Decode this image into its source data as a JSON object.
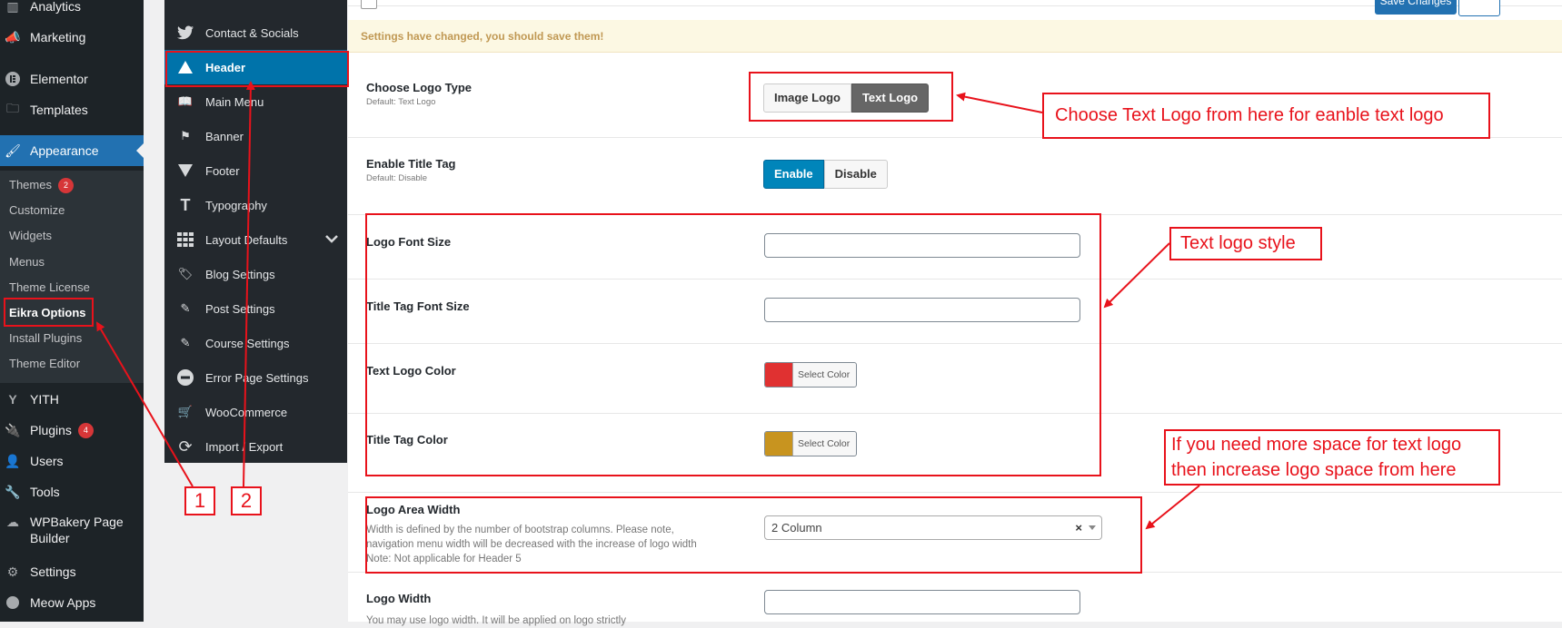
{
  "wp_menu": {
    "items": [
      {
        "label": "Analytics",
        "icon": "bar-chart-icon"
      },
      {
        "label": "Marketing",
        "icon": "megaphone-icon"
      },
      {
        "label": "Elementor",
        "icon": "elementor-icon"
      },
      {
        "label": "Templates",
        "icon": "folder-icon"
      },
      {
        "label": "Appearance",
        "icon": "paintbrush-icon"
      },
      {
        "label": "YITH",
        "icon": "yith-icon"
      },
      {
        "label": "Plugins",
        "icon": "plugin-icon",
        "badge": "4"
      },
      {
        "label": "Users",
        "icon": "user-icon"
      },
      {
        "label": "Tools",
        "icon": "wrench-icon"
      },
      {
        "label": "WPBakery Page Builder",
        "icon": "wpbakery-icon"
      },
      {
        "label": "Settings",
        "icon": "settings-sliders-icon"
      },
      {
        "label": "Meow Apps",
        "icon": "meow-apps-icon"
      }
    ],
    "submenu": [
      {
        "label": "Themes",
        "badge": "2"
      },
      {
        "label": "Customize"
      },
      {
        "label": "Widgets"
      },
      {
        "label": "Menus"
      },
      {
        "label": "Theme License"
      },
      {
        "label": "Eikra Options"
      },
      {
        "label": "Install Plugins"
      },
      {
        "label": "Theme Editor"
      }
    ]
  },
  "options_sidebar": {
    "items": [
      {
        "label": "Contact & Socials",
        "icon": "twitter-icon"
      },
      {
        "label": "Header",
        "icon": "triangle-up-icon"
      },
      {
        "label": "Main Menu",
        "icon": "book-icon"
      },
      {
        "label": "Banner",
        "icon": "flag-icon"
      },
      {
        "label": "Footer",
        "icon": "triangle-down-icon"
      },
      {
        "label": "Typography",
        "icon": "text-icon"
      },
      {
        "label": "Layout Defaults",
        "icon": "grid-icon"
      },
      {
        "label": "Blog Settings",
        "icon": "tags-icon"
      },
      {
        "label": "Post Settings",
        "icon": "edit-icon"
      },
      {
        "label": "Course Settings",
        "icon": "edit-icon"
      },
      {
        "label": "Error Page Settings",
        "icon": "minus-circle-icon"
      },
      {
        "label": "WooCommerce",
        "icon": "cart-icon"
      },
      {
        "label": "Import / Export",
        "icon": "refresh-icon"
      }
    ]
  },
  "toolbar": {
    "save_label": "Save Changes"
  },
  "notice": "Settings have changed, you should save them!",
  "fields": {
    "logo_type": {
      "label": "Choose Logo Type",
      "default": "Default: Text Logo",
      "options": [
        "Image Logo",
        "Text Logo"
      ],
      "selected": "Text Logo"
    },
    "title_tag": {
      "label": "Enable Title Tag",
      "default": "Default: Disable",
      "options": [
        "Enable",
        "Disable"
      ],
      "selected": "Enable"
    },
    "logo_font_size": {
      "label": "Logo Font Size",
      "value": ""
    },
    "title_tag_font_size": {
      "label": "Title Tag Font Size",
      "value": ""
    },
    "text_logo_color": {
      "label": "Text Logo Color",
      "button": "Select Color",
      "color": "#e03131"
    },
    "title_tag_color": {
      "label": "Title Tag Color",
      "button": "Select Color",
      "color": "#c8941f"
    },
    "logo_area_width": {
      "label": "Logo Area Width",
      "desc_lines": [
        "Width is defined by the number of bootstrap columns. Please note,",
        "navigation menu width will be decreased with the increase of logo width",
        "Note: Not applicable for Header 5"
      ],
      "value": "2 Column",
      "clear": "×"
    },
    "logo_width": {
      "label": "Logo Width",
      "desc": "You may use logo width. It will be applied on logo strictly",
      "value": ""
    }
  },
  "annotations": {
    "callout_text_logo": "Choose Text Logo from here for eanble text logo",
    "callout_style": "Text logo style",
    "callout_space_lines": [
      "If you need more space for text logo",
      "then increase logo space from here"
    ],
    "num1": "1",
    "num2": "2",
    "color": "#e8121b"
  }
}
